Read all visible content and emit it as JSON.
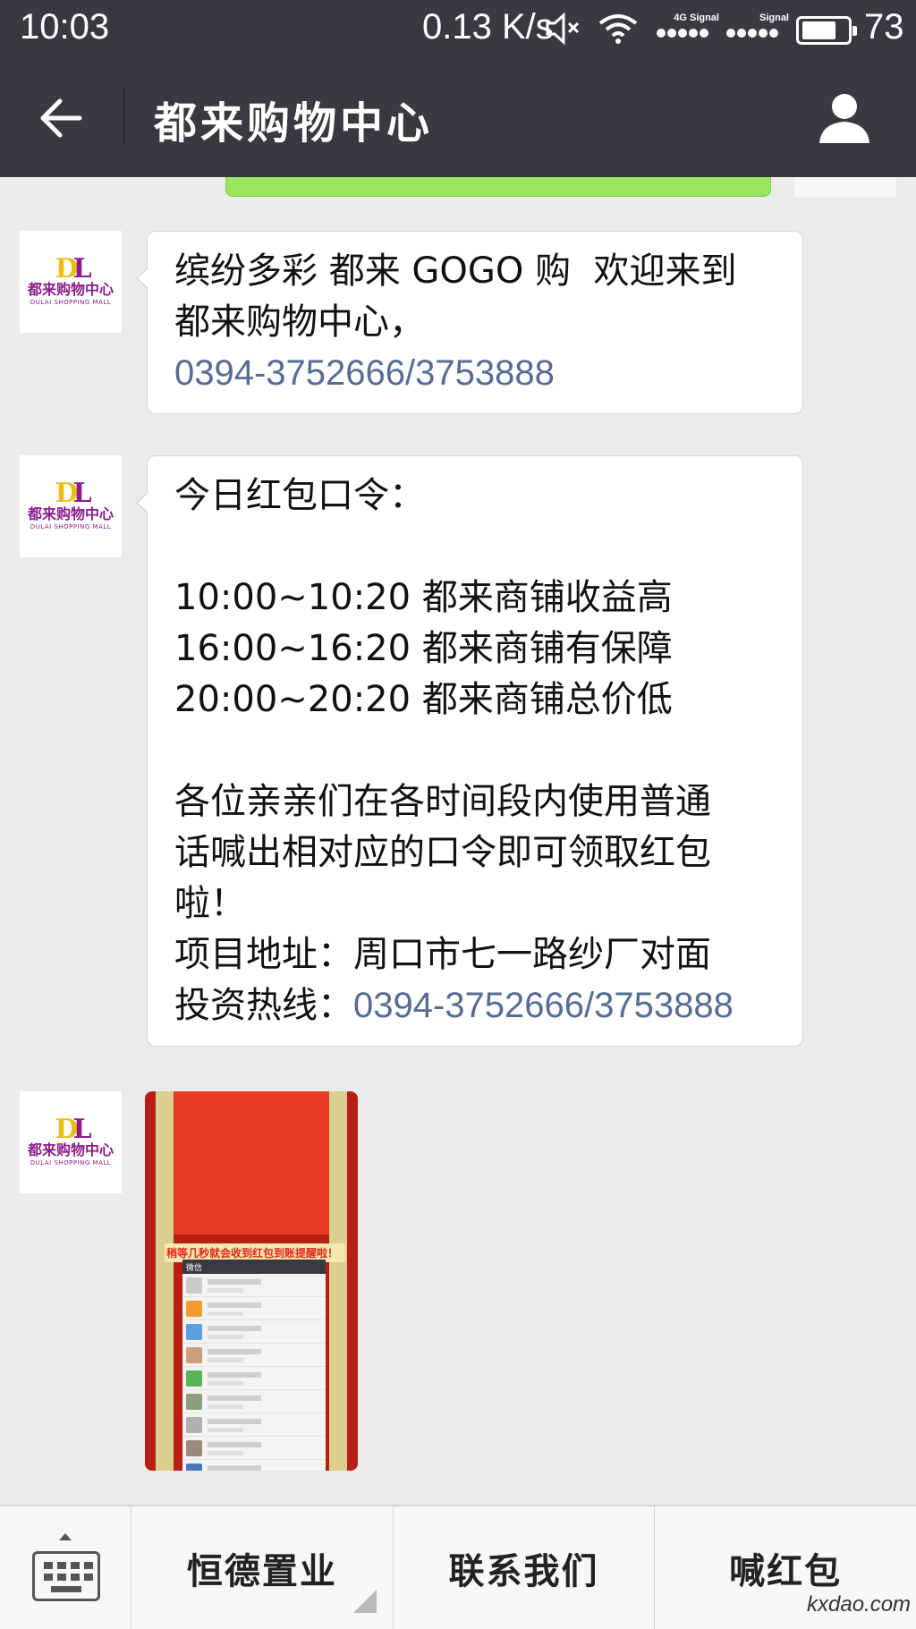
{
  "status_bar": {
    "time": "10:03",
    "net_speed": "0.13 K/s",
    "signal_1_label": "4G Signal",
    "signal_2_label": "Signal",
    "battery_percent": 73,
    "battery_label": "73",
    "icons": [
      "mute-icon",
      "wifi-icon",
      "signal-icon",
      "battery-icon"
    ]
  },
  "title_bar": {
    "title": "都来购物中心",
    "back_icon": "arrow-left-icon",
    "profile_icon": "person-icon"
  },
  "avatar": {
    "logo_letters": "DL",
    "logo_cn": "都来购物中心",
    "logo_en": "DULAI SHOPPING MALL"
  },
  "messages": [
    {
      "type": "text",
      "lines": [
        "缤纷多彩 都来 GOGO 购  欢迎来到",
        "都来购物中心，"
      ],
      "phone": "0394-3752666",
      "phone_sep": "/",
      "phone2": "3753888"
    },
    {
      "type": "text",
      "heading": "今日红包口令：",
      "schedule": [
        "10:00~10:20 都来商铺收益高",
        "16:00~16:20 都来商铺有保障",
        "20:00~20:20 都来商铺总价低"
      ],
      "body_lines": [
        "各位亲亲们在各时间段内使用普通",
        "话喊出相对应的口令即可领取红包",
        "啦！"
      ],
      "address": "项目地址：周口市七一路纱厂对面",
      "hotline_label": "投资热线：",
      "phone": "0394-3752666",
      "phone_sep": "/",
      "phone2": "3753888"
    },
    {
      "type": "image",
      "caption": "稍等几秒就会收到红包到账提醒啦！",
      "screen_header": "微信"
    }
  ],
  "menu": {
    "keyboard_icon": "keyboard-icon",
    "items": [
      {
        "label": "恒德置业"
      },
      {
        "label": "联系我们"
      },
      {
        "label": "喊红包"
      }
    ]
  },
  "watermark": "kxdao.com",
  "colors": {
    "title_bar": "#393a3f",
    "link": "#576b95",
    "chat_bg": "#ebebeb",
    "logo_purple": "#8b1d89",
    "logo_yellow": "#e9c01a"
  }
}
